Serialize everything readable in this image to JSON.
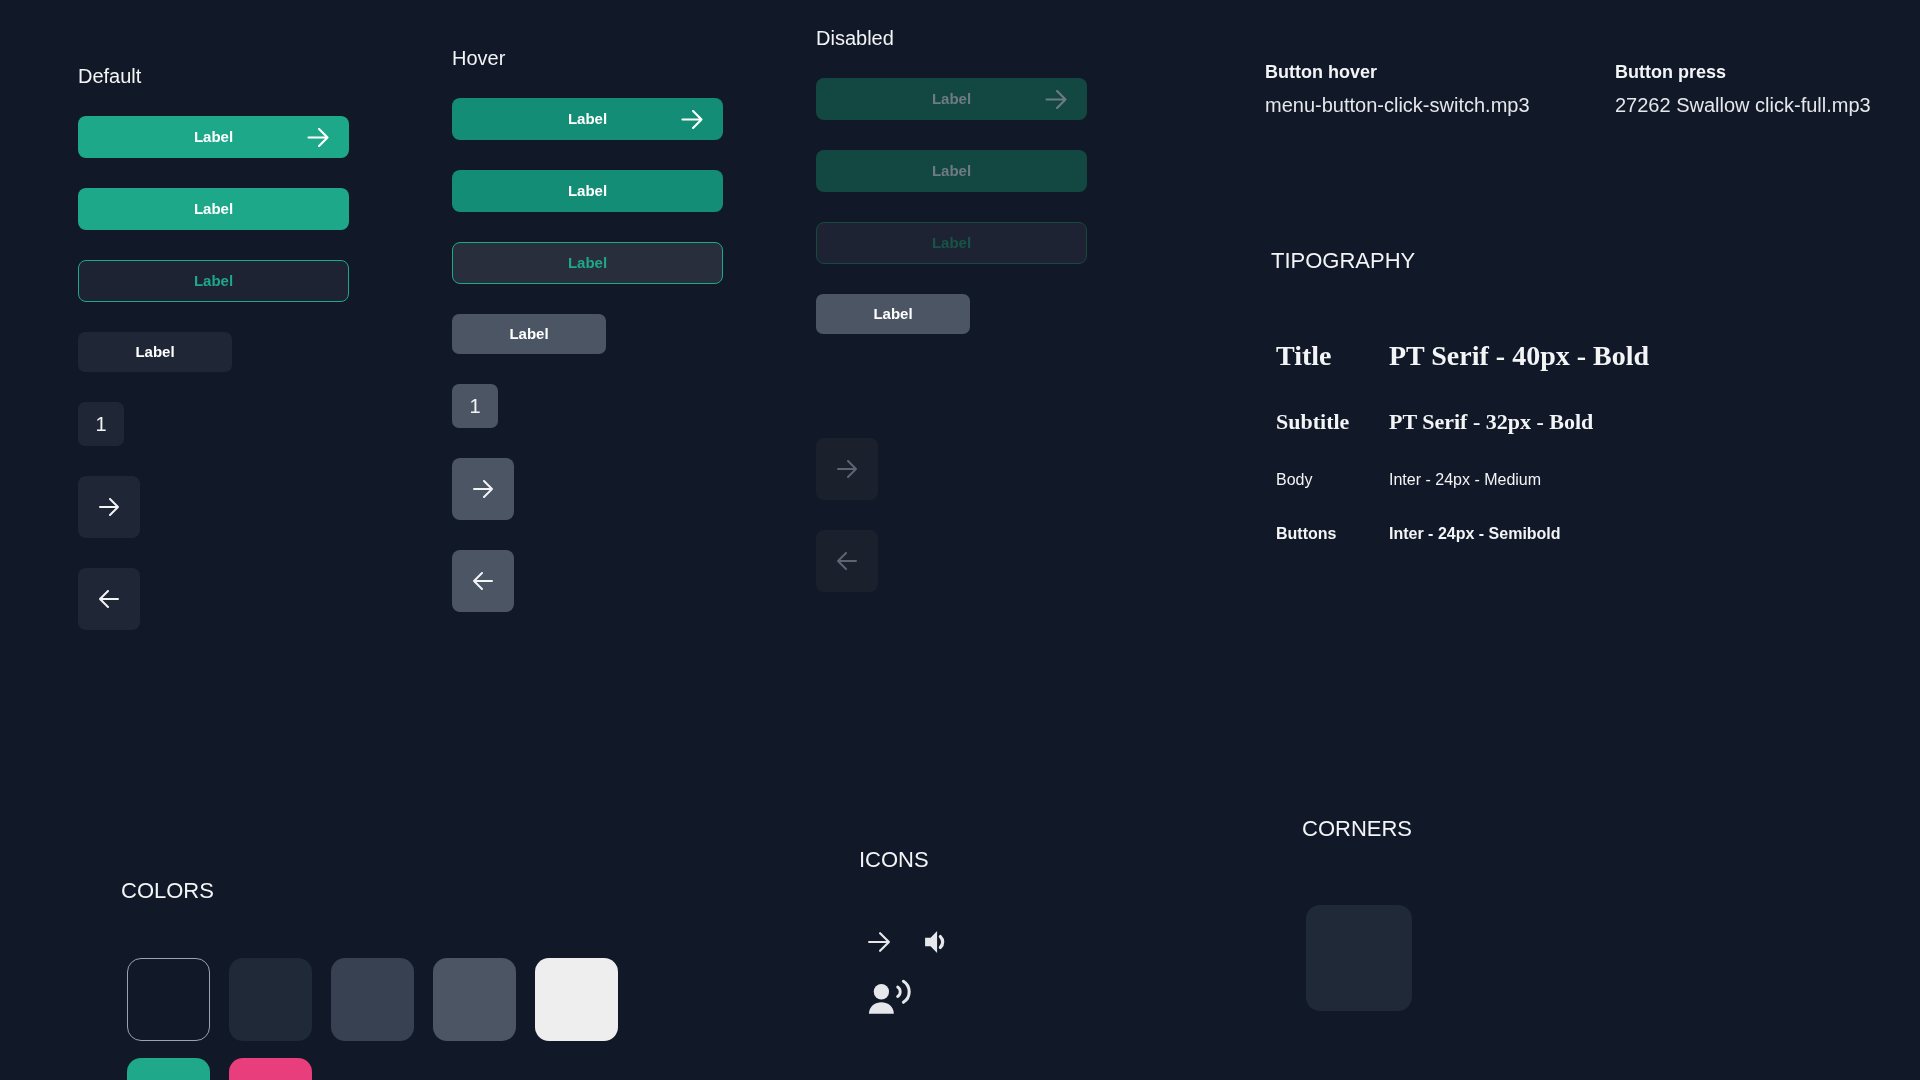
{
  "button_states": [
    {
      "heading": "Default",
      "hovered": false,
      "disabled": false,
      "buttons": [
        {
          "kind": "primary_arrow",
          "label": "Label"
        },
        {
          "kind": "primary",
          "label": "Label"
        },
        {
          "kind": "outline",
          "label": "Label"
        },
        {
          "kind": "secondary",
          "label": "Label"
        },
        {
          "kind": "number",
          "label": "1"
        },
        {
          "kind": "next"
        },
        {
          "kind": "back"
        }
      ]
    },
    {
      "heading": "Hover",
      "hovered": true,
      "disabled": false,
      "buttons": [
        {
          "kind": "primary_arrow",
          "label": "Label"
        },
        {
          "kind": "primary",
          "label": "Label"
        },
        {
          "kind": "outline",
          "label": "Label"
        },
        {
          "kind": "secondary",
          "label": "Label"
        },
        {
          "kind": "number",
          "label": "1"
        },
        {
          "kind": "next"
        },
        {
          "kind": "back"
        }
      ]
    },
    {
      "heading": "Disabled",
      "hovered": false,
      "disabled": true,
      "buttons": [
        {
          "kind": "primary_arrow",
          "label": "Label"
        },
        {
          "kind": "primary",
          "label": "Label"
        },
        {
          "kind": "outline",
          "label": "Label"
        },
        {
          "kind": "secondary",
          "label": "Label"
        },
        {
          "kind": "next"
        },
        {
          "kind": "back"
        }
      ]
    }
  ],
  "sounds": [
    {
      "event": "Button hover",
      "file": "menu-button-click-switch.mp3"
    },
    {
      "event": "Button press",
      "file": "27262 Swallow click-full.mp3"
    }
  ],
  "typography": {
    "heading": "TIPOGRAPHY",
    "styles": [
      {
        "kind": "title",
        "name": "Title",
        "spec": "PT Serif - 40px - Bold"
      },
      {
        "kind": "subtitle",
        "name": "Subtitle",
        "spec": "PT Serif - 32px - Bold"
      },
      {
        "kind": "body",
        "name": "Body",
        "spec": "Inter - 24px - Medium"
      },
      {
        "kind": "button",
        "name": "Buttons",
        "spec": "Inter - 24px - Semibold"
      }
    ]
  },
  "colors": {
    "heading": "COLORS",
    "rows": [
      {
        "swatches": [
          {
            "kind": "outlined",
            "color": "#111827"
          },
          {
            "kind": "filled",
            "color": "#1f2937"
          },
          {
            "kind": "filled",
            "color": "#374151"
          },
          {
            "kind": "filled",
            "color": "#4b5563"
          },
          {
            "kind": "filled",
            "color": "#eeeeee"
          }
        ]
      },
      {
        "swatches": [
          {
            "kind": "filled",
            "color": "#1fa98a"
          },
          {
            "kind": "filled",
            "color": "#e83e7c"
          }
        ]
      }
    ]
  },
  "icons": {
    "heading": "ICONS",
    "items": [
      {
        "kind": "arrow"
      },
      {
        "kind": "speaker"
      },
      {
        "kind": "voice"
      }
    ]
  },
  "corners": {
    "heading": "CORNERS"
  }
}
